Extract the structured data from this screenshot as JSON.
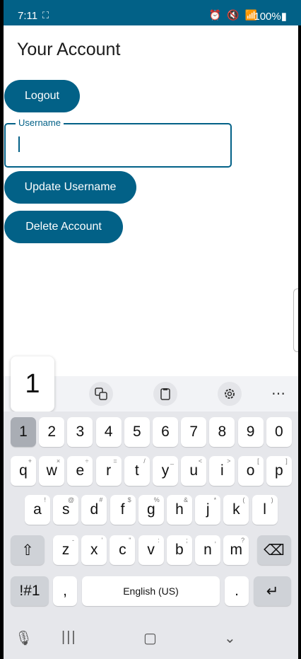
{
  "status": {
    "time": "7:11",
    "screen_icon": "⛶",
    "icons": "⏰ 🔇 📶",
    "battery": "100%▮"
  },
  "page": {
    "title": "Your Account"
  },
  "buttons": {
    "logout": "Logout",
    "update": "Update Username",
    "delete": "Delete Account"
  },
  "username_field": {
    "label": "Username",
    "value": ""
  },
  "keyboard": {
    "popup": "1",
    "numbers": [
      "1",
      "2",
      "3",
      "4",
      "5",
      "6",
      "7",
      "8",
      "9",
      "0"
    ],
    "row1": [
      {
        "k": "q",
        "s": "+"
      },
      {
        "k": "w",
        "s": "×"
      },
      {
        "k": "e",
        "s": "÷"
      },
      {
        "k": "r",
        "s": "="
      },
      {
        "k": "t",
        "s": "/"
      },
      {
        "k": "y",
        "s": "_"
      },
      {
        "k": "u",
        "s": "<"
      },
      {
        "k": "i",
        "s": ">"
      },
      {
        "k": "o",
        "s": "["
      },
      {
        "k": "p",
        "s": "]"
      }
    ],
    "row2": [
      {
        "k": "a",
        "s": "!"
      },
      {
        "k": "s",
        "s": "@"
      },
      {
        "k": "d",
        "s": "#"
      },
      {
        "k": "f",
        "s": "$"
      },
      {
        "k": "g",
        "s": "%"
      },
      {
        "k": "h",
        "s": "&"
      },
      {
        "k": "j",
        "s": "*"
      },
      {
        "k": "k",
        "s": "("
      },
      {
        "k": "l",
        "s": ")"
      }
    ],
    "row3": [
      {
        "k": "z",
        "s": "-"
      },
      {
        "k": "x",
        "s": "'"
      },
      {
        "k": "c",
        "s": "\""
      },
      {
        "k": "v",
        "s": ":"
      },
      {
        "k": "b",
        "s": ";"
      },
      {
        "k": "n",
        "s": ","
      },
      {
        "k": "m",
        "s": "?"
      }
    ],
    "sym": "!#1",
    "comma": ",",
    "space": "English (US)",
    "period": ".",
    "enter": "↵",
    "shift": "⇧",
    "backspace": "⌫"
  }
}
